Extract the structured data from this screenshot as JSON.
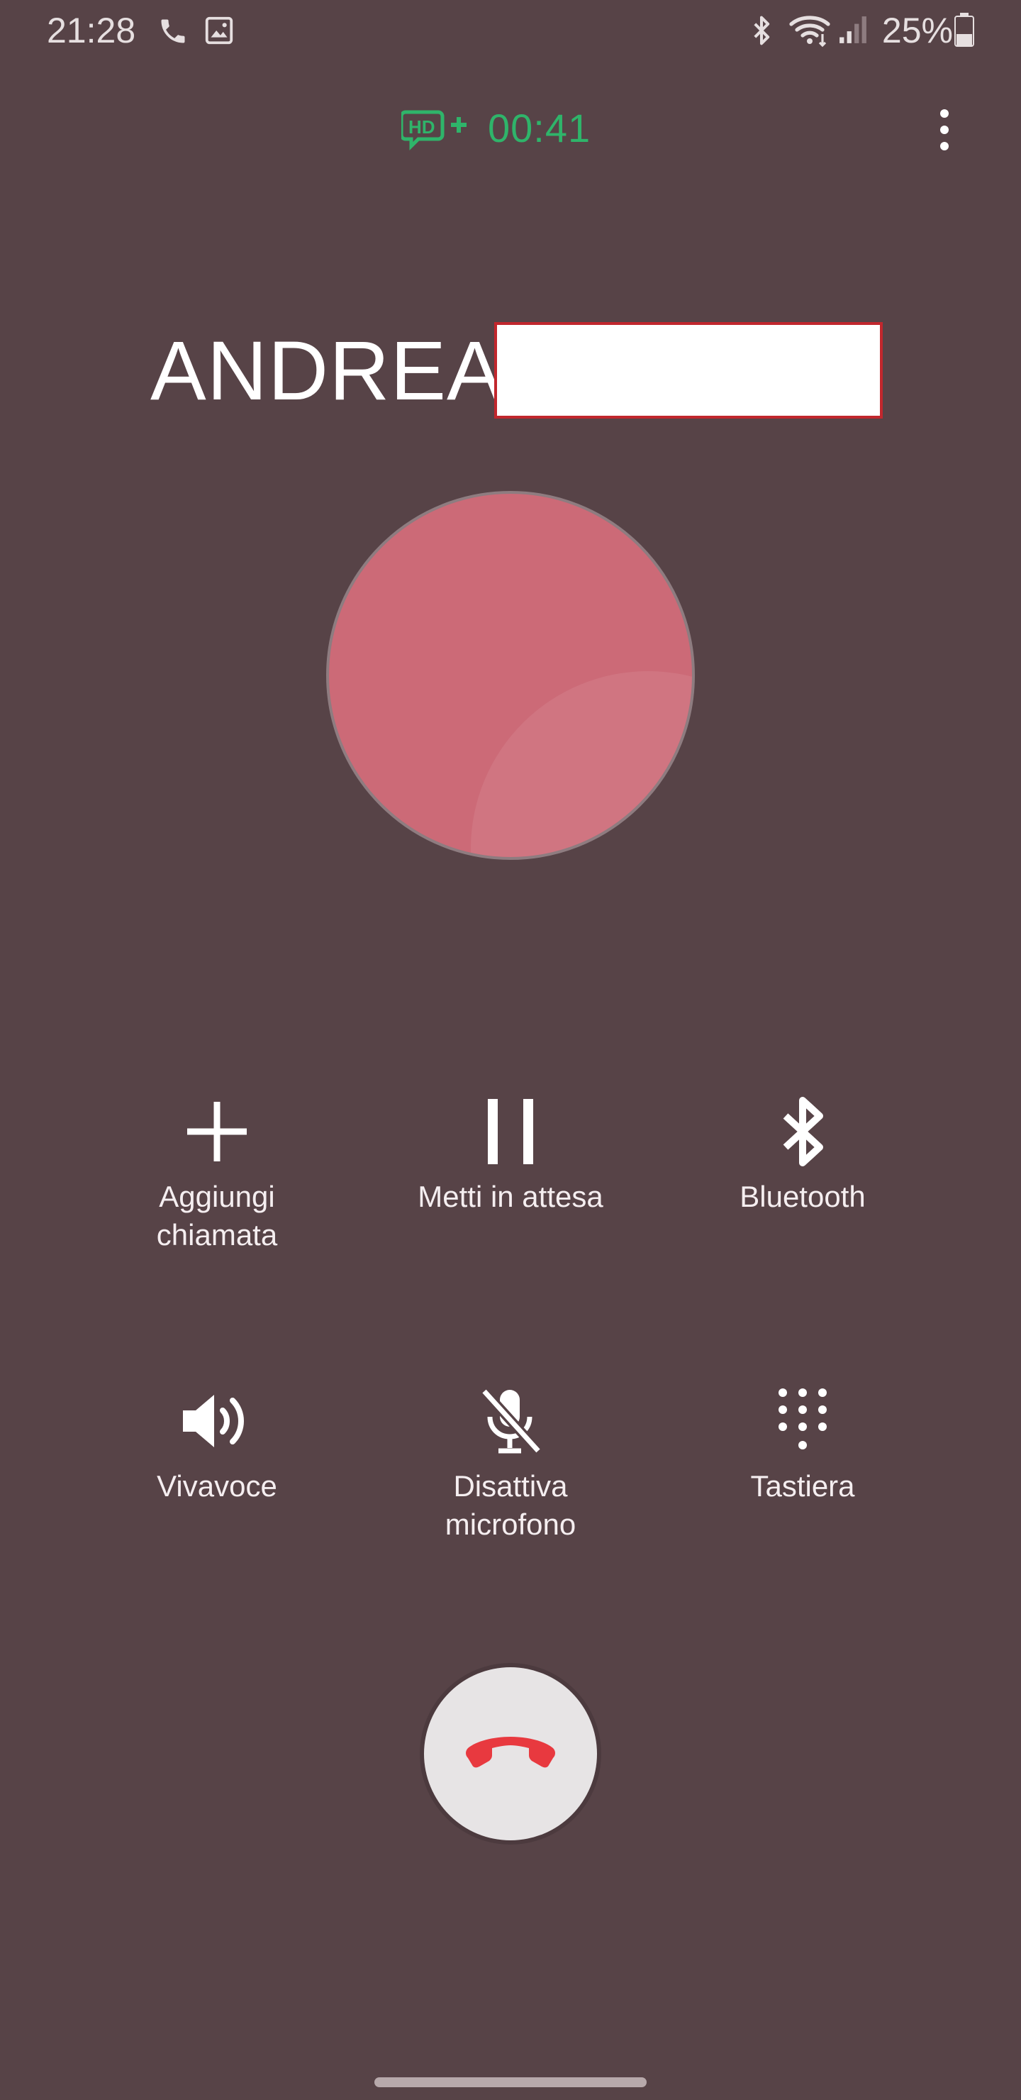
{
  "status_bar": {
    "time": "21:28",
    "battery_percent": "25%",
    "icons": [
      "phone-icon",
      "image-icon",
      "bluetooth-icon",
      "wifi-icon",
      "signal-icon",
      "battery-icon"
    ]
  },
  "call": {
    "hd_badge": "HD+",
    "timer": "00:41",
    "caller_name": "ANDREA"
  },
  "actions": [
    {
      "label": "Aggiungi\nchiamata",
      "icon": "plus-icon"
    },
    {
      "label": "Metti in attesa",
      "icon": "pause-icon"
    },
    {
      "label": "Bluetooth",
      "icon": "bluetooth-icon"
    },
    {
      "label": "Vivavoce",
      "icon": "speaker-icon"
    },
    {
      "label": "Disattiva\nmicrofono",
      "icon": "mic-off-icon"
    },
    {
      "label": "Tastiera",
      "icon": "keypad-icon"
    }
  ],
  "end_call": {
    "icon": "end-call-icon"
  },
  "colors": {
    "background": "#574347",
    "timer": "#2fb46a",
    "avatar": "#c9616f",
    "end_call_icon": "#e8393f",
    "end_call_button": "#e7e4e5"
  }
}
